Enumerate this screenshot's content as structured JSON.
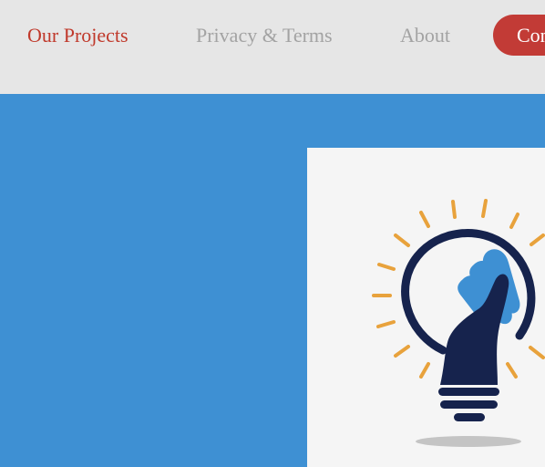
{
  "nav": {
    "items": [
      {
        "label": "Our Projects",
        "active": true
      },
      {
        "label": "Privacy & Terms",
        "active": false
      },
      {
        "label": "About",
        "active": false
      }
    ],
    "cta_label": "Contact"
  },
  "hero": {
    "image_icon": "lightbulb-hand-icon"
  },
  "colors": {
    "nav_background": "#e6e6e6",
    "active_link": "#c0392b",
    "inactive_link": "#a3a3a3",
    "cta_background": "#c23b36",
    "hero_background": "#3e90d3",
    "card_background": "#f5f5f5",
    "bulb_navy": "#16234d",
    "hand_blue": "#3e90d3",
    "ray_orange": "#e8a23c"
  }
}
